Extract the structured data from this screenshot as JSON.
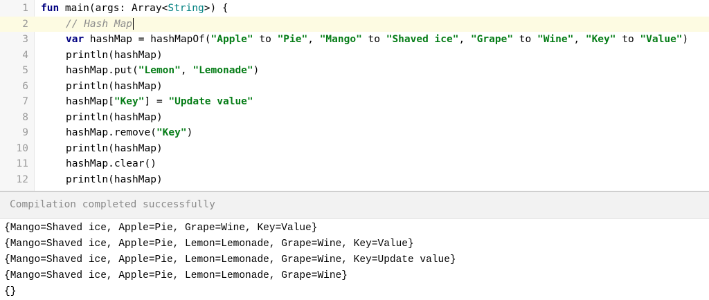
{
  "editor": {
    "line_numbers": [
      "1",
      "2",
      "3",
      "4",
      "5",
      "6",
      "7",
      "8",
      "9",
      "10",
      "11",
      "12"
    ],
    "l1": {
      "kw": "fun",
      "a": " main(args: Array<",
      "type": "String",
      "b": ">) {"
    },
    "l2": {
      "comment": "// Hash Map"
    },
    "l3": {
      "kw": "var",
      "a": " hashMap = hashMapOf(",
      "s1": "\"Apple\"",
      "t1": " to ",
      "s2": "\"Pie\"",
      "c1": ", ",
      "s3": "\"Mango\"",
      "t2": " to ",
      "s4": "\"Shaved ice\"",
      "c2": ", ",
      "s5": "\"Grape\"",
      "t3": " to ",
      "s6": "\"Wine\"",
      "c3": ", ",
      "s7": "\"Key\"",
      "t4": " to ",
      "s8": "\"Value\"",
      "z": ")"
    },
    "l4": "println(hashMap)",
    "l5": {
      "a": "hashMap.put(",
      "s1": "\"Lemon\"",
      "c": ", ",
      "s2": "\"Lemonade\"",
      "z": ")"
    },
    "l6": "println(hashMap)",
    "l7": {
      "a": "hashMap[",
      "s1": "\"Key\"",
      "b": "] = ",
      "s2": "\"Update value\""
    },
    "l8": "println(hashMap)",
    "l9": {
      "a": "hashMap.remove(",
      "s1": "\"Key\"",
      "z": ")"
    },
    "l10": "println(hashMap)",
    "l11": "hashMap.clear()",
    "l12": "println(hashMap)"
  },
  "output": {
    "status": "Compilation completed successfully",
    "lines": [
      "{Mango=Shaved ice, Apple=Pie, Grape=Wine, Key=Value}",
      "{Mango=Shaved ice, Apple=Pie, Lemon=Lemonade, Grape=Wine, Key=Value}",
      "{Mango=Shaved ice, Apple=Pie, Lemon=Lemonade, Grape=Wine, Key=Update value}",
      "{Mango=Shaved ice, Apple=Pie, Lemon=Lemonade, Grape=Wine}",
      "{}"
    ]
  },
  "colors": {
    "keyword": "#000080",
    "string": "#067d17",
    "type": "#008080",
    "comment": "#8c8c8c",
    "active_line": "#fdfbe2"
  }
}
